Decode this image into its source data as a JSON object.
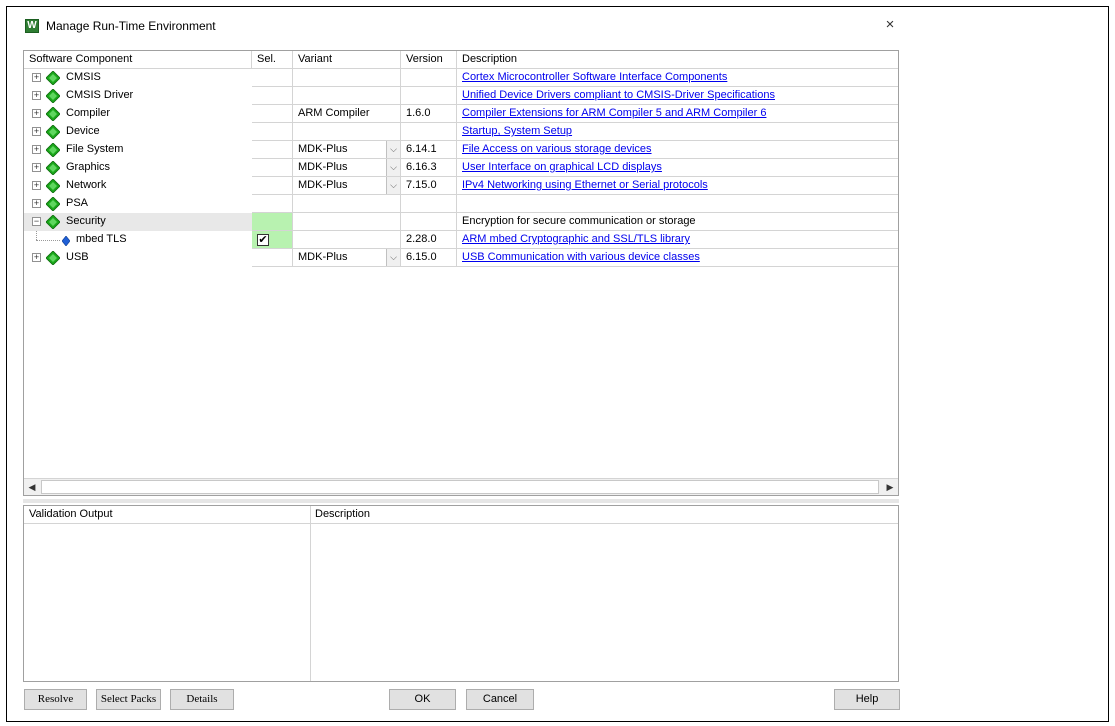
{
  "window": {
    "title": "Manage Run-Time Environment"
  },
  "colors": {
    "green_diamond": "#1aa81a",
    "link": "#0000ee",
    "selected_green": "#b8f2b0"
  },
  "table": {
    "headers": {
      "component": "Software Component",
      "sel": "Sel.",
      "variant": "Variant",
      "version": "Version",
      "description": "Description"
    },
    "rows": [
      {
        "name": "CMSIS",
        "expander": "+",
        "variant": "",
        "version": "",
        "description": "Cortex Microcontroller Software Interface Components",
        "link": true
      },
      {
        "name": "CMSIS Driver",
        "expander": "+",
        "variant": "",
        "version": "",
        "description": "Unified Device Drivers compliant to CMSIS-Driver Specifications",
        "link": true
      },
      {
        "name": "Compiler",
        "expander": "+",
        "variant": "ARM Compiler",
        "version": "1.6.0",
        "description": "Compiler Extensions for ARM Compiler 5 and ARM Compiler 6",
        "link": true
      },
      {
        "name": "Device",
        "expander": "+",
        "variant": "",
        "version": "",
        "description": "Startup, System Setup",
        "link": true
      },
      {
        "name": "File System",
        "expander": "+",
        "variant": "MDK-Plus",
        "version": "6.14.1",
        "description": "File Access on various storage devices",
        "link": true,
        "dropdown": true
      },
      {
        "name": "Graphics",
        "expander": "+",
        "variant": "MDK-Plus",
        "version": "6.16.3",
        "description": "User Interface on graphical LCD displays",
        "link": true,
        "dropdown": true
      },
      {
        "name": "Network",
        "expander": "+",
        "variant": "MDK-Plus",
        "version": "7.15.0",
        "description": "IPv4 Networking using Ethernet or Serial protocols",
        "link": true,
        "dropdown": true
      },
      {
        "name": "PSA",
        "expander": "+",
        "variant": "",
        "version": "",
        "description": "",
        "link": false
      },
      {
        "name": "Security",
        "expander": "−",
        "variant": "",
        "version": "",
        "description": "Encryption for secure communication or storage",
        "link": false
      },
      {
        "name": "mbed TLS",
        "child": true,
        "checked": true,
        "check_mark": "✔",
        "variant": "",
        "version": "2.28.0",
        "description": "ARM mbed Cryptographic and SSL/TLS library",
        "link": true
      },
      {
        "name": "USB",
        "expander": "+",
        "variant": "MDK-Plus",
        "version": "6.15.0",
        "description": "USB Communication with various device classes",
        "link": true,
        "dropdown": true
      }
    ]
  },
  "validation": {
    "output_header": "Validation Output",
    "description_header": "Description"
  },
  "buttons": {
    "resolve": "Resolve",
    "select_packs": "Select Packs",
    "details": "Details",
    "ok": "OK",
    "cancel": "Cancel",
    "help": "Help"
  },
  "icons": {
    "close": "×",
    "dropdown": "⌵",
    "scroll_left": "◀",
    "scroll_right": "▶"
  }
}
